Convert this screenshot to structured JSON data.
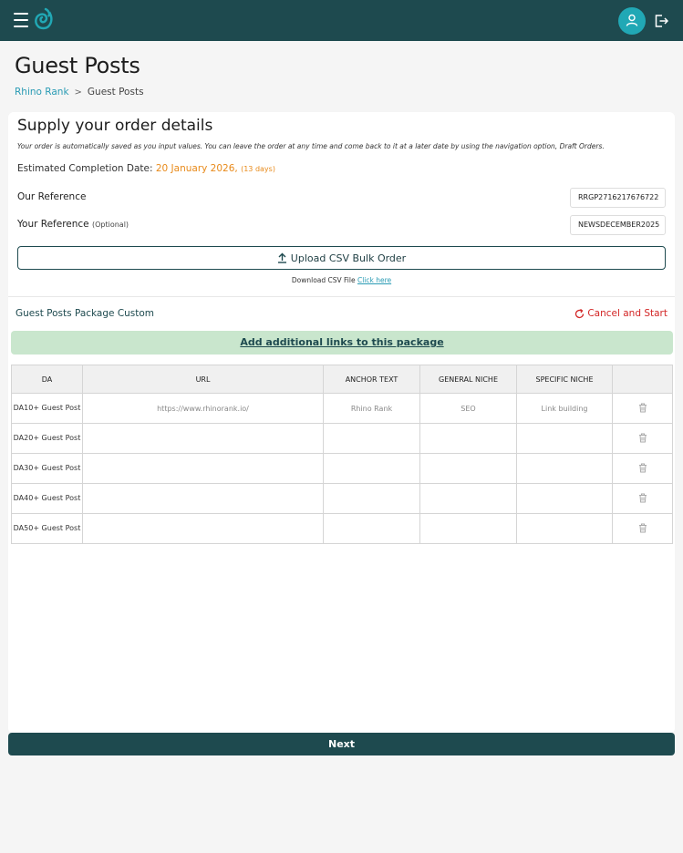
{
  "header": {
    "menu_icon": "hamburger-icon",
    "logo_icon": "brand-logo-icon",
    "avatar_icon": "user-icon",
    "logout_icon": "logout-icon",
    "bar_color": "#1e4a4f",
    "accent_color": "#21a8b5"
  },
  "page": {
    "title": "Guest Posts",
    "breadcrumb": [
      {
        "label": "Rhino Rank"
      },
      {
        "label": "Guest Posts"
      }
    ],
    "breadcrumb_separator": ">"
  },
  "order": {
    "title": "Supply your order details",
    "subtitle": "Your order is automatically saved as you input values. You can leave the order at any time and come back to it at a later date by using the navigation option, Draft Orders.",
    "est_label": "Estimated Completion Date:",
    "est_date": "20 January 2026,",
    "est_days": "(13 days)",
    "our_ref_label": "Our Reference",
    "our_ref_value": "RRGP2716217676722",
    "your_ref_label": "Your Reference",
    "your_ref_optional": "(Optional)",
    "your_ref_value": "NEWSDECEMBER2025",
    "upload_label": "Upload CSV Bulk Order",
    "upload_icon": "upload-icon",
    "download_text": "Download CSV File",
    "download_link": "Click here"
  },
  "package": {
    "title": "Guest Posts Package Custom",
    "cancel_label": "Cancel and Start",
    "cancel_icon": "refresh-icon",
    "add_links_label": "Add additional links to this package"
  },
  "table": {
    "columns": [
      "DA",
      "URL",
      "ANCHOR TEXT",
      "GENERAL NICHE",
      "SPECIFIC NICHE",
      ""
    ],
    "rows": [
      {
        "da": "DA10+ Guest Post",
        "url": "https://www.rhinorank.io/",
        "anchor": "Rhino Rank",
        "general": "SEO",
        "specific": "Link building"
      },
      {
        "da": "DA20+ Guest Post",
        "url": "",
        "anchor": "",
        "general": "",
        "specific": ""
      },
      {
        "da": "DA30+ Guest Post",
        "url": "",
        "anchor": "",
        "general": "",
        "specific": ""
      },
      {
        "da": "DA40+ Guest Post",
        "url": "",
        "anchor": "",
        "general": "",
        "specific": ""
      },
      {
        "da": "DA50+ Guest Post",
        "url": "",
        "anchor": "",
        "general": "",
        "specific": ""
      }
    ],
    "delete_icon": "trash-icon"
  },
  "footer": {
    "next_label": "Next"
  }
}
